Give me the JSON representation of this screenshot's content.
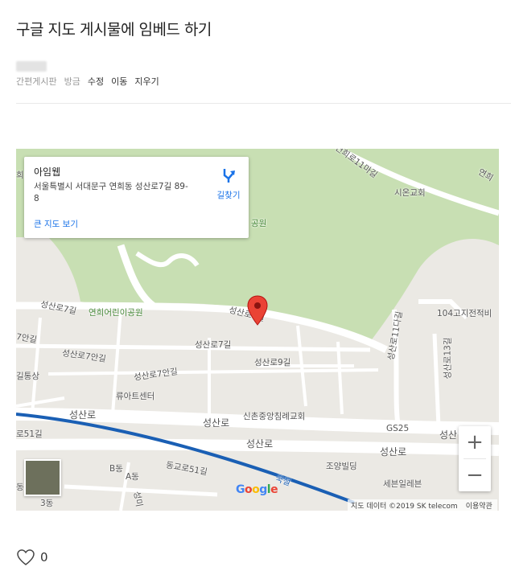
{
  "post": {
    "title": "구글 지도 게시물에 임베드 하기",
    "board": "간편게시판",
    "time": "방금",
    "actions": {
      "edit": "수정",
      "move": "이동",
      "delete": "지우기"
    }
  },
  "map": {
    "info": {
      "name": "아임웹",
      "address": "서울특별시 서대문구 연희동 성산로7길 89-8",
      "directions_label": "길찾기",
      "larger_map_link": "큰 지도 보기"
    },
    "labels": {
      "yeonhuiro11ma": "연희로11마길",
      "sionchurch": "시온교회",
      "yeonhui_edge": "연희",
      "yeonhui_edge_left": "희",
      "park_partial": "공원",
      "seongsanro7gil_a": "성산로7길",
      "childrens_park": "연희어린이공원",
      "seongsanro7gil_b": "성산로7길",
      "highpoint": "104고지전적비",
      "seongsanro7angil_left": "7안길",
      "seongsanro7gil_c": "성산로7길",
      "seongsanro7angil_a": "성산로7안길",
      "seongsanro9gil": "성산로9길",
      "seongsanro7angil_b": "성산로7안길",
      "seongsanro11da": "성산로11다길",
      "seongsanro13gil": "성산로13길",
      "tongsang": "길통상",
      "rueart": "류아트센터",
      "sinchon_church": "신촌중앙침례교회",
      "gs25": "GS25",
      "seongsanro_a": "성산로",
      "seongsanro_b": "성산로",
      "seongsanro_c": "성산로",
      "seongsanro_d": "성산로",
      "seongsanro_e": "성산",
      "ro51gil": "로51길",
      "choyang": "조양빌딩",
      "seven_eleven": "세븐일레븐",
      "bdong": "B동",
      "adong": "A동",
      "donggyoro51gil": "동교로51길",
      "railway": "국철",
      "sam_dong": "3동",
      "dong_left": "동",
      "seongmi": "성미"
    },
    "google_letters": [
      "G",
      "o",
      "o",
      "g",
      "l",
      "e"
    ],
    "google_colors": [
      "#4285F4",
      "#EA4335",
      "#FBBC05",
      "#4285F4",
      "#34A853",
      "#EA4335"
    ],
    "attribution": "지도 데이터 ©2019 SK telecom",
    "terms": "이용약관",
    "zoom_in": "+",
    "zoom_out": "−",
    "colors": {
      "park": "#c8dfb3",
      "land": "#ebe9e4",
      "road": "#ffffff",
      "rail": "#1a5fb4",
      "pin": "#ea4335",
      "link": "#1a73e8"
    }
  },
  "likes": {
    "count": "0"
  }
}
